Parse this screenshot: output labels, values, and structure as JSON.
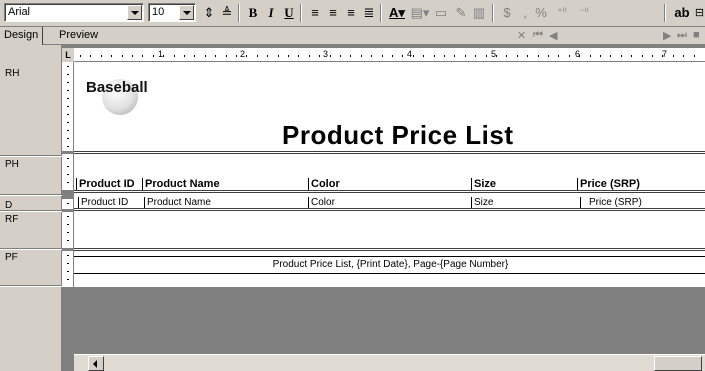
{
  "toolbar": {
    "font_name": "Arial",
    "font_size": "10",
    "icons": [
      "grow-font-icon",
      "shrink-font-icon",
      "bold-icon",
      "italic-icon",
      "underline-icon",
      "align-left-icon",
      "align-center-icon",
      "align-right-icon",
      "justify-icon",
      "font-color-icon",
      "fill-color-icon",
      "border-icon",
      "currency-icon",
      "comma-icon",
      "percent-icon",
      "increase-decimal-icon",
      "decrease-decimal-icon",
      "text-box-icon"
    ],
    "bold_label": "B",
    "italic_label": "I",
    "underline_label": "U",
    "textbox_label": "ab"
  },
  "tabs": [
    {
      "label": "Design",
      "active": true
    },
    {
      "label": "Preview",
      "active": false
    }
  ],
  "bands": [
    "RH",
    "PH",
    "D",
    "RF",
    "PF"
  ],
  "ruler": {
    "numbers": [
      "1",
      "2",
      "3",
      "4",
      "5",
      "6",
      "7"
    ],
    "corner": "L"
  },
  "report": {
    "logo_text": "Baseball",
    "title": "Product Price List",
    "headers": [
      "Product ID",
      "Product Name",
      "Color",
      "Size",
      "Price (SRP)"
    ],
    "fields": [
      "Product ID",
      "Product Name",
      "Color",
      "Size",
      "Price (SRP)"
    ],
    "footer": "Product Price List, {Print Date}, Page-{Page Number}"
  }
}
